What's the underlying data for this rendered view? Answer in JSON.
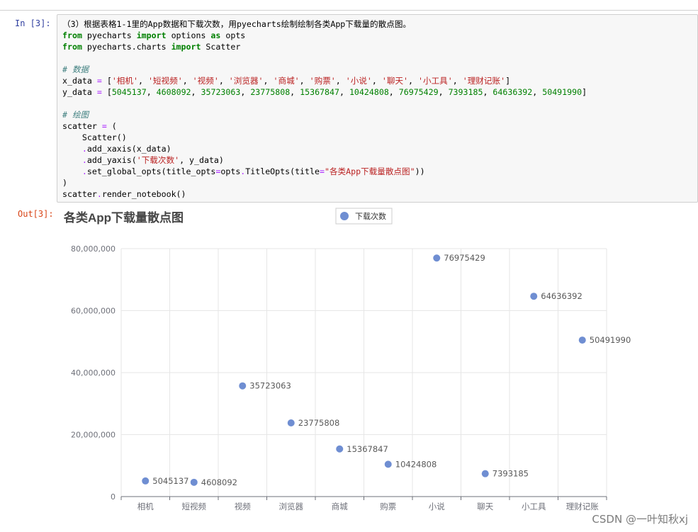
{
  "notebook": {
    "in_prompt": "In [3]:",
    "out_prompt": "Out[3]:",
    "code_lines": [
      [
        {
          "t": "（3）根据表格1-1里的App数据和下载次数，用pyecharts绘制绘制各类App下载量的散点图。",
          "c": ""
        }
      ],
      [
        {
          "t": "from",
          "c": "kw"
        },
        {
          "t": " pyecharts ",
          "c": ""
        },
        {
          "t": "import",
          "c": "kw"
        },
        {
          "t": " options ",
          "c": ""
        },
        {
          "t": "as",
          "c": "kw"
        },
        {
          "t": " opts",
          "c": ""
        }
      ],
      [
        {
          "t": "from",
          "c": "kw"
        },
        {
          "t": " pyecharts.charts ",
          "c": ""
        },
        {
          "t": "import",
          "c": "kw"
        },
        {
          "t": " Scatter",
          "c": ""
        }
      ],
      [],
      [
        {
          "t": "# 数据",
          "c": "cm"
        }
      ],
      [
        {
          "t": "x_data ",
          "c": ""
        },
        {
          "t": "=",
          "c": "op"
        },
        {
          "t": " [",
          "c": ""
        },
        {
          "t": "'相机'",
          "c": "str"
        },
        {
          "t": ", ",
          "c": ""
        },
        {
          "t": "'短视频'",
          "c": "str"
        },
        {
          "t": ", ",
          "c": ""
        },
        {
          "t": "'视频'",
          "c": "str"
        },
        {
          "t": ", ",
          "c": ""
        },
        {
          "t": "'浏览器'",
          "c": "str"
        },
        {
          "t": ", ",
          "c": ""
        },
        {
          "t": "'商城'",
          "c": "str"
        },
        {
          "t": ", ",
          "c": ""
        },
        {
          "t": "'购票'",
          "c": "str"
        },
        {
          "t": ", ",
          "c": ""
        },
        {
          "t": "'小说'",
          "c": "str"
        },
        {
          "t": ", ",
          "c": ""
        },
        {
          "t": "'聊天'",
          "c": "str"
        },
        {
          "t": ", ",
          "c": ""
        },
        {
          "t": "'小工具'",
          "c": "str"
        },
        {
          "t": ", ",
          "c": ""
        },
        {
          "t": "'理财记账'",
          "c": "str"
        },
        {
          "t": "]",
          "c": ""
        }
      ],
      [
        {
          "t": "y_data ",
          "c": ""
        },
        {
          "t": "=",
          "c": "op"
        },
        {
          "t": " [",
          "c": ""
        },
        {
          "t": "5045137",
          "c": "num"
        },
        {
          "t": ", ",
          "c": ""
        },
        {
          "t": "4608092",
          "c": "num"
        },
        {
          "t": ", ",
          "c": ""
        },
        {
          "t": "35723063",
          "c": "num"
        },
        {
          "t": ", ",
          "c": ""
        },
        {
          "t": "23775808",
          "c": "num"
        },
        {
          "t": ", ",
          "c": ""
        },
        {
          "t": "15367847",
          "c": "num"
        },
        {
          "t": ", ",
          "c": ""
        },
        {
          "t": "10424808",
          "c": "num"
        },
        {
          "t": ", ",
          "c": ""
        },
        {
          "t": "76975429",
          "c": "num"
        },
        {
          "t": ", ",
          "c": ""
        },
        {
          "t": "7393185",
          "c": "num"
        },
        {
          "t": ", ",
          "c": ""
        },
        {
          "t": "64636392",
          "c": "num"
        },
        {
          "t": ", ",
          "c": ""
        },
        {
          "t": "50491990",
          "c": "num"
        },
        {
          "t": "]",
          "c": ""
        }
      ],
      [],
      [
        {
          "t": "# 绘图",
          "c": "cm"
        }
      ],
      [
        {
          "t": "scatter ",
          "c": ""
        },
        {
          "t": "=",
          "c": "op"
        },
        {
          "t": " (",
          "c": ""
        }
      ],
      [
        {
          "t": "    Scatter()",
          "c": ""
        }
      ],
      [
        {
          "t": "    ",
          "c": ""
        },
        {
          "t": ".",
          "c": "op"
        },
        {
          "t": "add_xaxis(x_data)",
          "c": ""
        }
      ],
      [
        {
          "t": "    ",
          "c": ""
        },
        {
          "t": ".",
          "c": "op"
        },
        {
          "t": "add_yaxis(",
          "c": ""
        },
        {
          "t": "'下载次数'",
          "c": "str"
        },
        {
          "t": ", y_data)",
          "c": ""
        }
      ],
      [
        {
          "t": "    ",
          "c": ""
        },
        {
          "t": ".",
          "c": "op"
        },
        {
          "t": "set_global_opts(title_opts",
          "c": ""
        },
        {
          "t": "=",
          "c": "op"
        },
        {
          "t": "opts",
          "c": ""
        },
        {
          "t": ".",
          "c": "op"
        },
        {
          "t": "TitleOpts(title",
          "c": ""
        },
        {
          "t": "=",
          "c": "op"
        },
        {
          "t": "\"各类App下载量散点图\"",
          "c": "str"
        },
        {
          "t": "))",
          "c": ""
        }
      ],
      [
        {
          "t": ")",
          "c": ""
        }
      ],
      [
        {
          "t": "scatter",
          "c": ""
        },
        {
          "t": ".",
          "c": "op"
        },
        {
          "t": "render_notebook()",
          "c": ""
        }
      ]
    ]
  },
  "chart_data": {
    "type": "scatter",
    "title": "各类App下载量散点图",
    "categories": [
      "相机",
      "短视频",
      "视频",
      "浏览器",
      "商城",
      "购票",
      "小说",
      "聊天",
      "小工具",
      "理财记账"
    ],
    "series": [
      {
        "name": "下载次数",
        "values": [
          5045137,
          4608092,
          35723063,
          23775808,
          15367847,
          10424808,
          76975429,
          7393185,
          64636392,
          50491990
        ],
        "color": "#6f8ed2"
      }
    ],
    "ylim": [
      0,
      80000000
    ],
    "y_ticks": [
      "0",
      "20,000,000",
      "40,000,000",
      "60,000,000",
      "80,000,000"
    ],
    "grid": true,
    "legend_position": "top-center"
  },
  "watermark": "CSDN @一叶知秋xj"
}
